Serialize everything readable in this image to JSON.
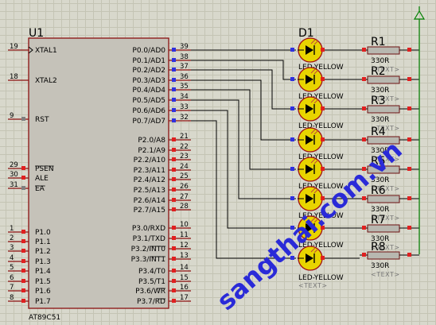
{
  "chip": {
    "ref": "U1",
    "part": "AT89C51",
    "left_pins": [
      {
        "num": "19",
        "name": "XTAL1",
        "mark": "clock"
      },
      {
        "num": "18",
        "name": "XTAL2",
        "mark": "none"
      },
      {
        "num": "9",
        "name": "RST",
        "mark": "grey"
      },
      {
        "num": "29",
        "name": "PSEN",
        "mark": "red",
        "overline": "PSEN"
      },
      {
        "num": "30",
        "name": "ALE",
        "mark": "red",
        "overline": ""
      },
      {
        "num": "31",
        "name": "EA",
        "mark": "grey",
        "overline": "EA"
      },
      {
        "num": "1",
        "name": "P1.0",
        "mark": "red"
      },
      {
        "num": "2",
        "name": "P1.1",
        "mark": "red"
      },
      {
        "num": "3",
        "name": "P1.2",
        "mark": "red"
      },
      {
        "num": "4",
        "name": "P1.3",
        "mark": "red"
      },
      {
        "num": "5",
        "name": "P1.4",
        "mark": "red"
      },
      {
        "num": "6",
        "name": "P1.5",
        "mark": "red"
      },
      {
        "num": "7",
        "name": "P1.6",
        "mark": "red"
      },
      {
        "num": "8",
        "name": "P1.7",
        "mark": "red"
      }
    ],
    "right_pins": [
      {
        "num": "39",
        "name": "P0.0/AD0",
        "mark": "blue"
      },
      {
        "num": "38",
        "name": "P0.1/AD1",
        "mark": "blue"
      },
      {
        "num": "37",
        "name": "P0.2/AD2",
        "mark": "blue"
      },
      {
        "num": "36",
        "name": "P0.3/AD3",
        "mark": "blue"
      },
      {
        "num": "35",
        "name": "P0.4/AD4",
        "mark": "blue"
      },
      {
        "num": "34",
        "name": "P0.5/AD5",
        "mark": "blue"
      },
      {
        "num": "33",
        "name": "P0.6/AD6",
        "mark": "blue"
      },
      {
        "num": "32",
        "name": "P0.7/AD7",
        "mark": "blue"
      },
      {
        "num": "21",
        "name": "P2.0/A8",
        "mark": "red"
      },
      {
        "num": "22",
        "name": "P2.1/A9",
        "mark": "red"
      },
      {
        "num": "23",
        "name": "P2.2/A10",
        "mark": "red"
      },
      {
        "num": "24",
        "name": "P2.3/A11",
        "mark": "red"
      },
      {
        "num": "25",
        "name": "P2.4/A12",
        "mark": "red"
      },
      {
        "num": "26",
        "name": "P2.5/A13",
        "mark": "red"
      },
      {
        "num": "27",
        "name": "P2.6/A14",
        "mark": "red"
      },
      {
        "num": "28",
        "name": "P2.7/A15",
        "mark": "red"
      },
      {
        "num": "10",
        "name": "P3.0/RXD",
        "mark": "red"
      },
      {
        "num": "11",
        "name": "P3.1/TXD",
        "mark": "red"
      },
      {
        "num": "12",
        "name": "P3.2/INT0",
        "mark": "red",
        "overline": "INT0"
      },
      {
        "num": "13",
        "name": "P3.3/INT1",
        "mark": "red",
        "overline": "INT1"
      },
      {
        "num": "14",
        "name": "P3.4/T0",
        "mark": "red"
      },
      {
        "num": "15",
        "name": "P3.5/T1",
        "mark": "red"
      },
      {
        "num": "16",
        "name": "P3.6/WR",
        "mark": "red",
        "overline": "WR"
      },
      {
        "num": "17",
        "name": "P3.7/RD",
        "mark": "red",
        "overline": "RD"
      }
    ]
  },
  "led_ref": "D1",
  "led_label": "LED-YELLOW",
  "text_placeholder": "<TEXT>",
  "resistors": [
    {
      "ref": "R1",
      "value": "330R"
    },
    {
      "ref": "R2",
      "value": "330R"
    },
    {
      "ref": "R3",
      "value": "330R"
    },
    {
      "ref": "R4",
      "value": "330R"
    },
    {
      "ref": "R5",
      "value": "330R"
    },
    {
      "ref": "R6",
      "value": "330R"
    },
    {
      "ref": "R7",
      "value": "330R"
    },
    {
      "ref": "R8",
      "value": "330R"
    }
  ],
  "watermark": "sangthai.com.vn",
  "colors": {
    "wire": "#000000",
    "chip_fill": "#c5c2b9",
    "chip_border": "#8b1010",
    "pin": "#8b1010",
    "led_fill": "#e8d400",
    "led_ring": "#a01010",
    "resistor_fill": "#b8b8b0",
    "power": "#008000",
    "marker_red": "#e02020",
    "marker_blue": "#3030e0",
    "marker_grey": "#808080",
    "watermark": "#2a2ad8"
  }
}
